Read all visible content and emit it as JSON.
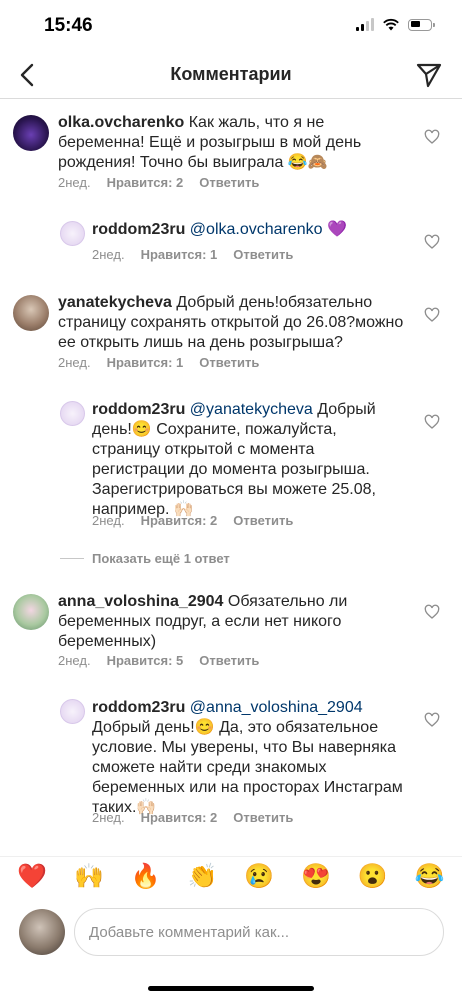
{
  "status_bar": {
    "time": "15:46"
  },
  "header": {
    "title": "Комментарии"
  },
  "comments": [
    {
      "username": "olka.ovcharenko",
      "mention": "",
      "text_lines": [
        "Как жаль, что я не",
        "беременна! Ещё и розыгрыш в мой день",
        "рождения! Точно бы выиграла 😂🙈"
      ],
      "time": "2нед.",
      "likes": "Нравится: 2",
      "reply": "Ответить"
    },
    {
      "username": "roddom23ru",
      "mention": "@olka.ovcharenko",
      "text_lines": [
        "💜"
      ],
      "time": "2нед.",
      "likes": "Нравится: 1",
      "reply": "Ответить"
    },
    {
      "username": "yanatekycheva",
      "mention": "",
      "text_lines": [
        "Добрый день!обязательно",
        "страницу сохранять открытой до 26.08?можно",
        "ее открыть лишь на день розыгрыша?"
      ],
      "time": "2нед.",
      "likes": "Нравится: 1",
      "reply": "Ответить"
    },
    {
      "username": "roddom23ru",
      "mention": "@yanatekycheva",
      "text_lines": [
        "Добрый",
        "день!😊 Сохраните, пожалуйста,",
        "страницу открытой с момента",
        "регистрации до момента розыгрыша.",
        "Зарегистрироваться вы можете 25.08,",
        "например. 🙌🏻"
      ],
      "time": "2нед.",
      "likes": "Нравится: 2",
      "reply": "Ответить"
    },
    {
      "username": "anna_voloshina_2904",
      "mention": "",
      "text_lines": [
        "Обязательно ли",
        "беременных подруг, а если нет никого",
        "беременных)"
      ],
      "time": "2нед.",
      "likes": "Нравится: 5",
      "reply": "Ответить"
    },
    {
      "username": "roddom23ru",
      "mention": "@anna_voloshina_2904",
      "text_lines": [
        "",
        "Добрый день!😊 Да, это обязательное",
        "условие. Мы уверены, что Вы наверняка",
        "сможете найти среди знакомых",
        "беременных или на просторах Инстаграм",
        "таких.🙌🏻"
      ],
      "time": "2нед.",
      "likes": "Нравится: 2",
      "reply": "Ответить"
    }
  ],
  "more_replies": "Показать ещё 1 ответ",
  "emoji_bar": [
    "❤️",
    "🙌",
    "🔥",
    "👏",
    "😢",
    "😍",
    "😮",
    "😂"
  ],
  "input": {
    "placeholder": "Добавьте комментарий как..."
  },
  "icons": {
    "back": "chevron-left-icon",
    "send": "paper-plane-icon",
    "like": "heart-outline-icon"
  },
  "colors": {
    "mention": "#00376b",
    "meta": "#8e8e8e",
    "text": "#262626",
    "divider": "#dbdbdb"
  }
}
